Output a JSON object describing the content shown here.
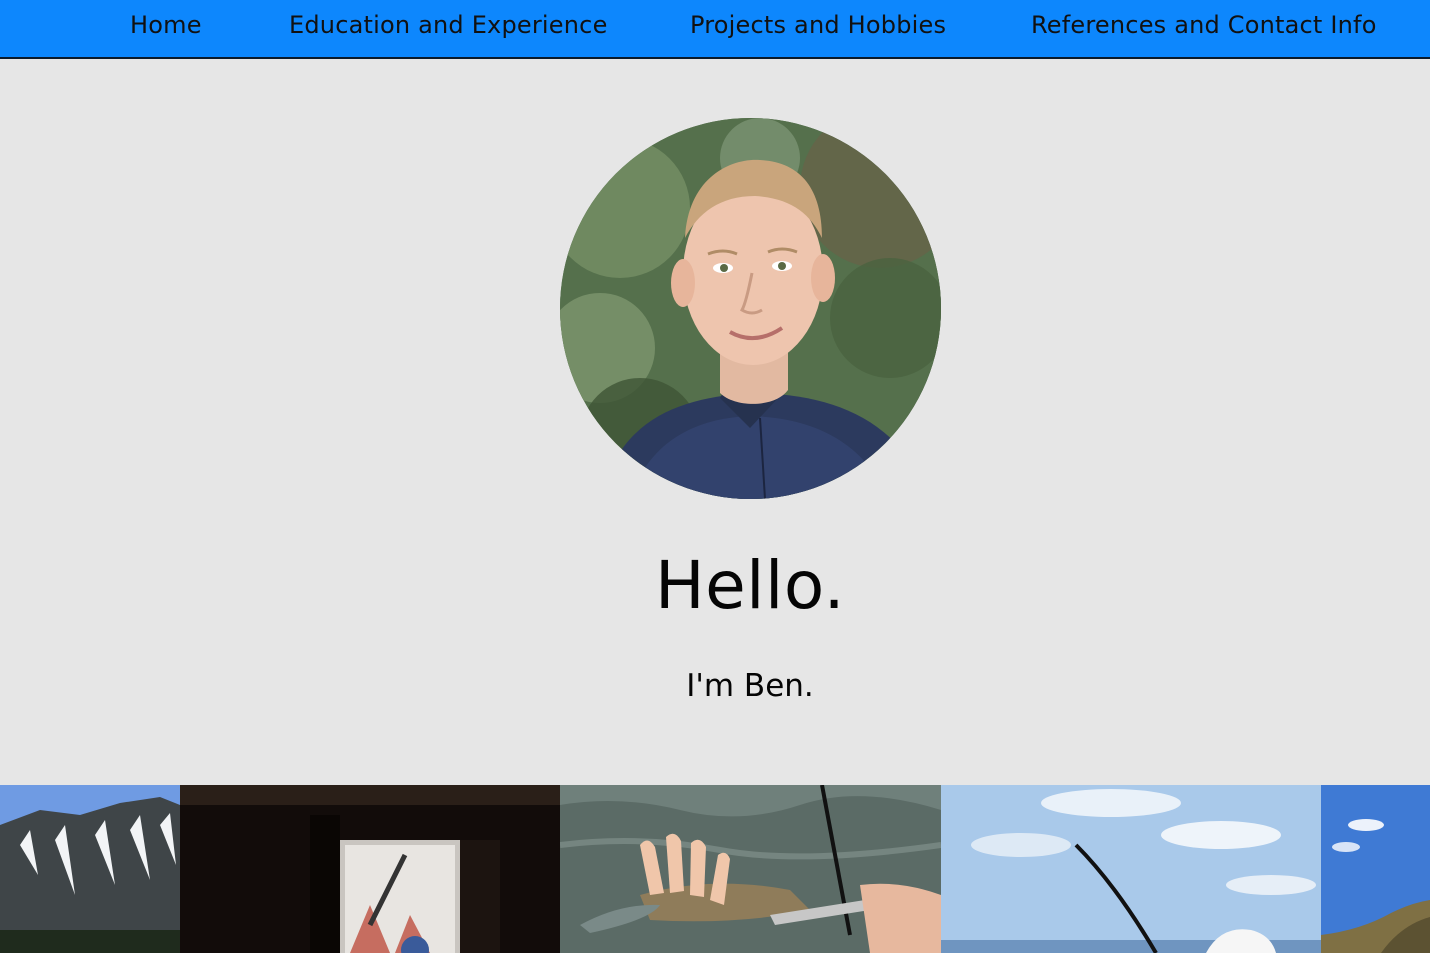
{
  "nav": {
    "items": [
      {
        "label": "Home"
      },
      {
        "label": "Education and Experience"
      },
      {
        "label": "Projects and Hobbies"
      },
      {
        "label": "References and Contact Info"
      }
    ]
  },
  "hero": {
    "greeting": "Hello.",
    "intro": "I'm Ben."
  },
  "colors": {
    "nav_background": "#0d87fd",
    "page_background": "#e6e6e6",
    "text": "#050505"
  }
}
